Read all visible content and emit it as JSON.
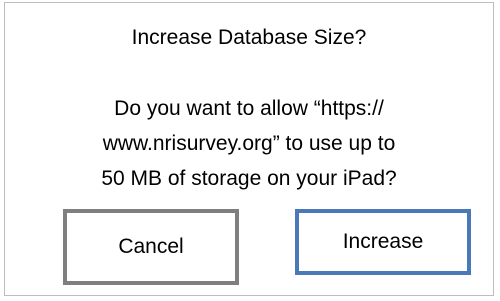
{
  "dialog": {
    "title": "Increase Database Size?",
    "message_lines": [
      "Do you want to allow “https://",
      "www.nrisurvey.org” to use up to",
      "50 MB of storage on your iPad?"
    ],
    "buttons": {
      "cancel_label": "Cancel",
      "increase_label": "Increase"
    },
    "colors": {
      "cancel_border": "#7f7f7f",
      "increase_border": "#4a78b8",
      "dialog_border": "#bdbdbd"
    }
  }
}
